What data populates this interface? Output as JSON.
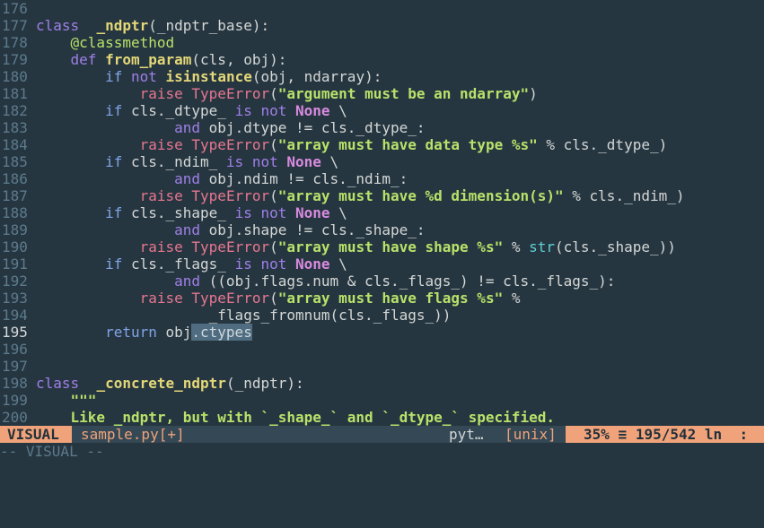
{
  "editor": {
    "lines": [
      {
        "num": "176",
        "tokens": []
      },
      {
        "num": "177",
        "tokens": [
          [
            "kw",
            "class"
          ],
          [
            "",
            "  "
          ],
          [
            "def",
            "_ndptr"
          ],
          [
            "",
            "(_ndptr_base):"
          ]
        ]
      },
      {
        "num": "178",
        "tokens": [
          [
            "",
            "    "
          ],
          [
            "dec",
            "@classmethod"
          ]
        ]
      },
      {
        "num": "179",
        "tokens": [
          [
            "",
            "    "
          ],
          [
            "kw",
            "def"
          ],
          [
            "",
            " "
          ],
          [
            "def",
            "from_param"
          ],
          [
            "",
            "(cls, obj):"
          ]
        ]
      },
      {
        "num": "180",
        "tokens": [
          [
            "",
            "        "
          ],
          [
            "ret",
            "if"
          ],
          [
            "",
            " "
          ],
          [
            "kw",
            "not"
          ],
          [
            "",
            " "
          ],
          [
            "def",
            "isinstance"
          ],
          [
            "",
            "(obj, ndarray):"
          ]
        ]
      },
      {
        "num": "181",
        "tokens": [
          [
            "",
            "            "
          ],
          [
            "exc",
            "raise"
          ],
          [
            "",
            " "
          ],
          [
            "exc",
            "TypeError"
          ],
          [
            "",
            "("
          ],
          [
            "str",
            "\"argument must be an ndarray\""
          ],
          [
            "",
            ")"
          ]
        ]
      },
      {
        "num": "182",
        "tokens": [
          [
            "",
            "        "
          ],
          [
            "ret",
            "if"
          ],
          [
            "",
            " cls._dtype_ "
          ],
          [
            "kw",
            "is not"
          ],
          [
            "",
            " "
          ],
          [
            "const",
            "None"
          ],
          [
            "",
            " \\"
          ]
        ]
      },
      {
        "num": "183",
        "tokens": [
          [
            "",
            "                "
          ],
          [
            "kw",
            "and"
          ],
          [
            "",
            " obj.dtype != cls._dtype_:"
          ]
        ]
      },
      {
        "num": "184",
        "tokens": [
          [
            "",
            "            "
          ],
          [
            "exc",
            "raise"
          ],
          [
            "",
            " "
          ],
          [
            "exc",
            "TypeError"
          ],
          [
            "",
            "("
          ],
          [
            "str",
            "\"array must have data type %s\""
          ],
          [
            "",
            " % cls._dtype_)"
          ]
        ]
      },
      {
        "num": "185",
        "tokens": [
          [
            "",
            "        "
          ],
          [
            "ret",
            "if"
          ],
          [
            "",
            " cls._ndim_ "
          ],
          [
            "kw",
            "is not"
          ],
          [
            "",
            " "
          ],
          [
            "const",
            "None"
          ],
          [
            "",
            " \\"
          ]
        ]
      },
      {
        "num": "186",
        "tokens": [
          [
            "",
            "                "
          ],
          [
            "kw",
            "and"
          ],
          [
            "",
            " obj.ndim != cls._ndim_:"
          ]
        ]
      },
      {
        "num": "187",
        "tokens": [
          [
            "",
            "            "
          ],
          [
            "exc",
            "raise"
          ],
          [
            "",
            " "
          ],
          [
            "exc",
            "TypeError"
          ],
          [
            "",
            "("
          ],
          [
            "str",
            "\"array must have %d dimension(s)\""
          ],
          [
            "",
            " % cls._ndim_)"
          ]
        ]
      },
      {
        "num": "188",
        "tokens": [
          [
            "",
            "        "
          ],
          [
            "ret",
            "if"
          ],
          [
            "",
            " cls._shape_ "
          ],
          [
            "kw",
            "is not"
          ],
          [
            "",
            " "
          ],
          [
            "const",
            "None"
          ],
          [
            "",
            " \\"
          ]
        ]
      },
      {
        "num": "189",
        "tokens": [
          [
            "",
            "                "
          ],
          [
            "kw",
            "and"
          ],
          [
            "",
            " obj.shape != cls._shape_:"
          ]
        ]
      },
      {
        "num": "190",
        "tokens": [
          [
            "",
            "            "
          ],
          [
            "exc",
            "raise"
          ],
          [
            "",
            " "
          ],
          [
            "exc",
            "TypeError"
          ],
          [
            "",
            "("
          ],
          [
            "str",
            "\"array must have shape %s\""
          ],
          [
            "",
            " % "
          ],
          [
            "bi",
            "str"
          ],
          [
            "",
            "(cls._shape_))"
          ]
        ]
      },
      {
        "num": "191",
        "tokens": [
          [
            "",
            "        "
          ],
          [
            "ret",
            "if"
          ],
          [
            "",
            " cls._flags_ "
          ],
          [
            "kw",
            "is not"
          ],
          [
            "",
            " "
          ],
          [
            "const",
            "None"
          ],
          [
            "",
            " \\"
          ]
        ]
      },
      {
        "num": "192",
        "tokens": [
          [
            "",
            "                "
          ],
          [
            "kw",
            "and"
          ],
          [
            "",
            " ((obj.flags.num & cls._flags_) != cls._flags_):"
          ]
        ]
      },
      {
        "num": "193",
        "tokens": [
          [
            "",
            "            "
          ],
          [
            "exc",
            "raise"
          ],
          [
            "",
            " "
          ],
          [
            "exc",
            "TypeError"
          ],
          [
            "",
            "("
          ],
          [
            "str",
            "\"array must have flags %s\""
          ],
          [
            "",
            " %"
          ]
        ]
      },
      {
        "num": "194",
        "tokens": [
          [
            "",
            "                    _flags_fromnum(cls._flags_))"
          ]
        ]
      },
      {
        "num": "195",
        "tokens": [
          [
            "",
            "        "
          ],
          [
            "ret",
            "return"
          ],
          [
            "",
            " obj"
          ],
          [
            "sel",
            ".ctypes"
          ]
        ],
        "current": true
      },
      {
        "num": "196",
        "tokens": []
      },
      {
        "num": "197",
        "tokens": []
      },
      {
        "num": "198",
        "tokens": [
          [
            "kw",
            "class"
          ],
          [
            "",
            "  "
          ],
          [
            "def",
            "_concrete_ndptr"
          ],
          [
            "",
            "(_ndptr):"
          ]
        ]
      },
      {
        "num": "199",
        "tokens": [
          [
            "",
            "    "
          ],
          [
            "doc",
            "\"\"\""
          ]
        ]
      },
      {
        "num": "200",
        "tokens": [
          [
            "",
            "    "
          ],
          [
            "doc",
            "Like _ndptr, but with `_shape_` and `_dtype_` specified."
          ]
        ]
      }
    ]
  },
  "statusbar": {
    "mode": "VISUAL",
    "filename": "sample.py[+]",
    "filetype": "pyt…",
    "fileformat": "[unix]",
    "percent": "35%",
    "lines_icon": "≡",
    "position": "195/542",
    "ln_label": "ln",
    "col_sep": ":"
  },
  "cmdline": {
    "text": "-- VISUAL --"
  }
}
